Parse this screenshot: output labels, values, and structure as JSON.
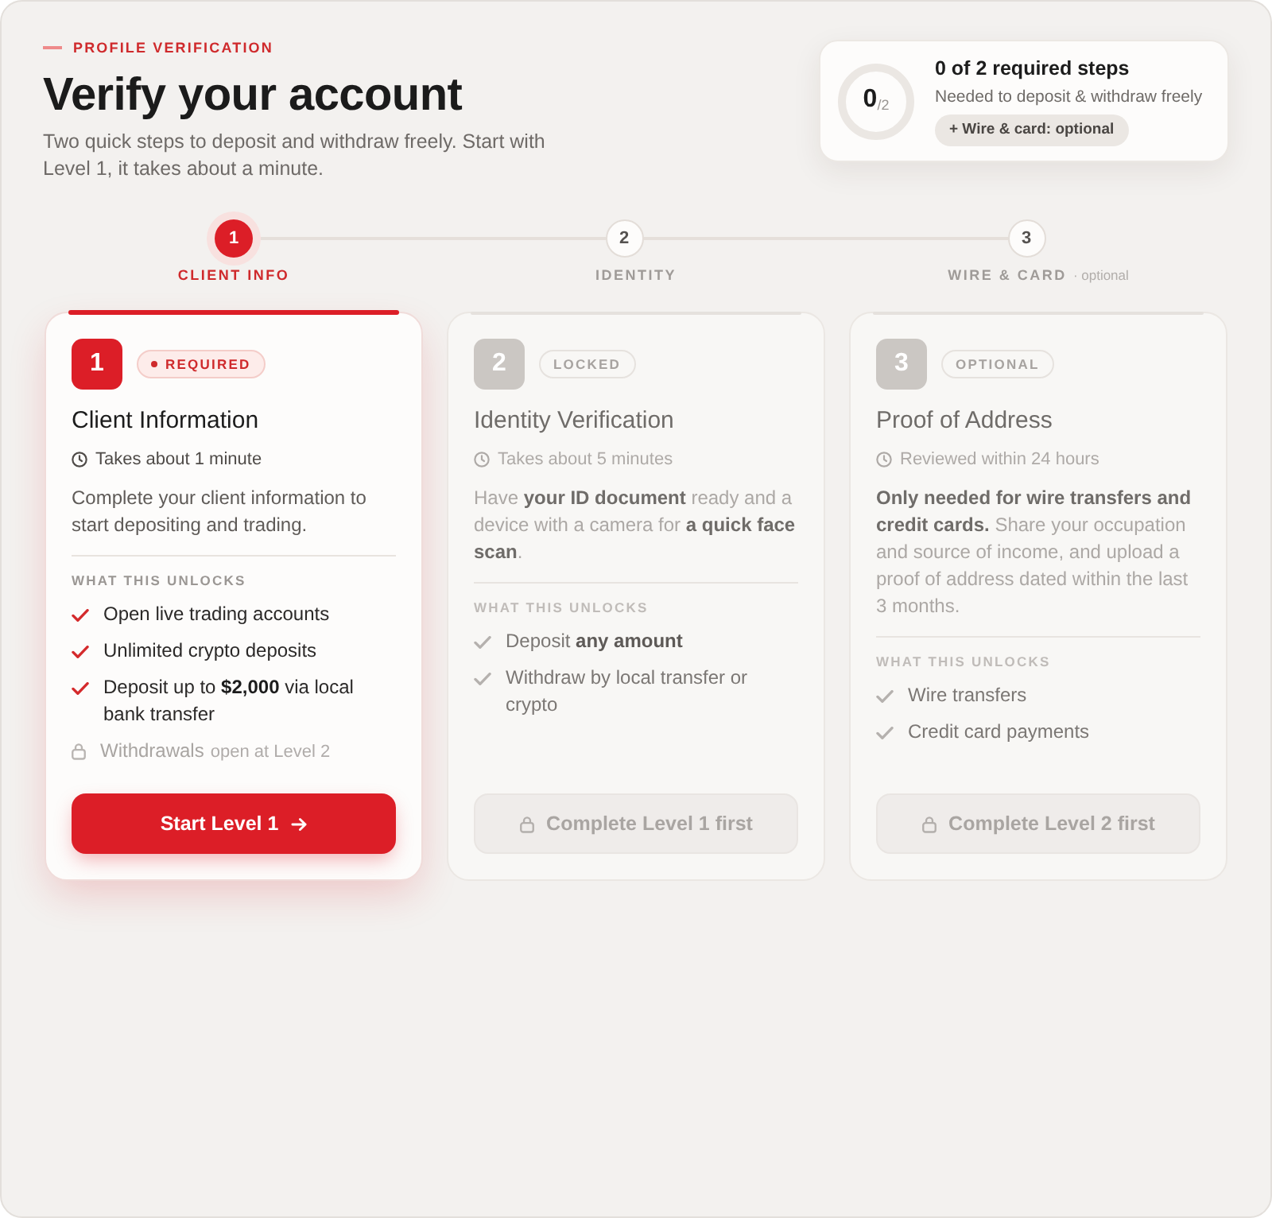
{
  "header": {
    "eyebrow": "PROFILE VERIFICATION",
    "title": "Verify your account",
    "subtitle": "Two quick steps to deposit and withdraw freely. Start with Level 1, it takes about a minute."
  },
  "progress": {
    "count": "0",
    "total": "/2",
    "title": "0 of 2 required steps",
    "subtitle": "Needed to deposit & withdraw freely",
    "pill": "+ Wire & card: optional"
  },
  "stepper": [
    {
      "number": "1",
      "label": "CLIENT INFO",
      "selected": true
    },
    {
      "number": "2",
      "label": "IDENTITY",
      "selected": false
    },
    {
      "number": "3",
      "label": "WIRE & CARD",
      "note": "· optional",
      "selected": false
    }
  ],
  "cards": [
    {
      "number": "1",
      "active": true,
      "badge": {
        "label": "REQUIRED",
        "kind": "required"
      },
      "title": "Client Information",
      "time": "Takes about 1 minute",
      "description": "Complete your client information to start depositing and trading.",
      "unlocks_heading": "WHAT THIS UNLOCKS",
      "unlocks": [
        {
          "kind": "check",
          "text": "Open live trading accounts"
        },
        {
          "kind": "check",
          "text": "Unlimited crypto deposits"
        },
        {
          "kind": "check",
          "text": "Deposit up to **$2,000** via local bank transfer"
        },
        {
          "kind": "locked",
          "text": "Withdrawals",
          "note": "open at Level 2"
        }
      ],
      "button": {
        "label": "Start Level 1",
        "disabled": false
      }
    },
    {
      "number": "2",
      "active": false,
      "badge": {
        "label": "LOCKED",
        "kind": "neutral"
      },
      "title": "Identity Verification",
      "time": "Takes about 5 minutes",
      "description": "Have **your ID document** ready and a device with a camera for **a quick face scan**.",
      "unlocks_heading": "WHAT THIS UNLOCKS",
      "unlocks": [
        {
          "kind": "check",
          "text": "Deposit **any amount**"
        },
        {
          "kind": "check",
          "text": "Withdraw by local transfer or crypto"
        }
      ],
      "button": {
        "label": "Complete Level 1 first",
        "disabled": true
      }
    },
    {
      "number": "3",
      "active": false,
      "badge": {
        "label": "OPTIONAL",
        "kind": "neutral"
      },
      "title": "Proof of Address",
      "time": "Reviewed within 24 hours",
      "description": "**Only needed for wire transfers and credit cards.** Share your occupation and source of income, and upload a proof of address dated within the last 3 months.",
      "unlocks_heading": "WHAT THIS UNLOCKS",
      "unlocks": [
        {
          "kind": "check",
          "text": "Wire transfers"
        },
        {
          "kind": "check",
          "text": "Credit card payments"
        }
      ],
      "button": {
        "label": "Complete Level 2 first",
        "disabled": true
      }
    }
  ]
}
